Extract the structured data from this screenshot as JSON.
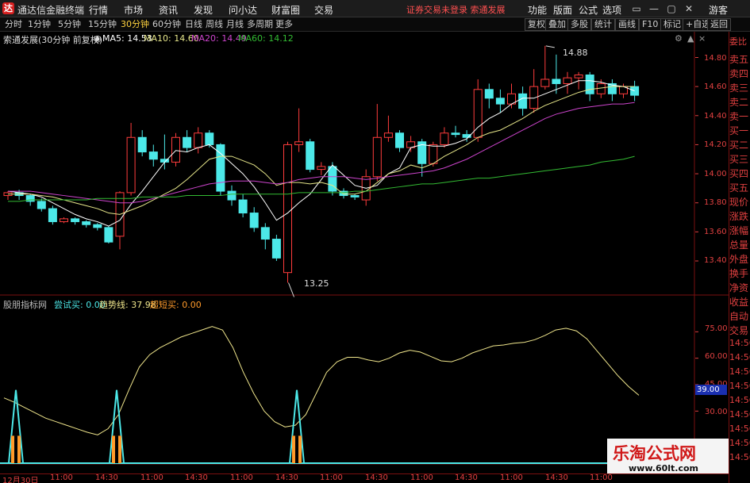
{
  "titlebar": {
    "logo": "达",
    "app_name": "通达信金融终端",
    "menus": [
      "行情",
      "市场",
      "资讯",
      "发现",
      "问小达",
      "财富圈",
      "交易"
    ],
    "notice": "证券交易未登录  索通发展",
    "right_menus": [
      "功能",
      "版面",
      "公式",
      "选项"
    ],
    "guest": "游客",
    "window_buttons": [
      "▭",
      "—",
      "▢",
      "✕"
    ]
  },
  "periodbar": {
    "tabs": [
      "分时",
      "1分钟",
      "5分钟",
      "15分钟",
      "30分钟",
      "60分钟",
      "日线",
      "周线",
      "月线",
      "多周期",
      "更多"
    ],
    "active": "30分钟",
    "tools": [
      "复权",
      "叠加",
      "多股",
      "统计",
      "画线",
      "F10",
      "标记",
      "+自选",
      "返回"
    ]
  },
  "main_legend": {
    "stock": "索通发展(30分钟 前复权)",
    "ma5": "MA5: 14.53",
    "ma10": "MA10: 14.60",
    "ma20": "MA20: 14.49",
    "ma60": "MA60: 14.12",
    "high_label": "14.88",
    "low_label": "13.25",
    "colors": {
      "ma5": "#ffffff",
      "ma10": "#e6e68a",
      "ma20": "#cc44cc",
      "ma60": "#33bb33",
      "up": "#ff3c3c",
      "down": "#4ce8e8"
    }
  },
  "indicator_legend": {
    "name": "股朋指标网",
    "try_buy": "尝试买: 0.00",
    "trend": "趋势线: 37.98",
    "super_buy": "超短买: 0.00",
    "current_value": "39.00"
  },
  "right_panel": {
    "items": [
      "委比",
      "卖五",
      "卖四",
      "卖三",
      "卖二",
      "卖一",
      "买一",
      "买二",
      "买三",
      "买四",
      "买五",
      "现价",
      "涨跌",
      "涨幅",
      "总量",
      "外盘",
      "换手",
      "净资",
      "收益",
      "自动",
      "交易"
    ],
    "times": [
      "14:56",
      "14:56",
      "14:56",
      "14:56",
      "14:56",
      "14:56",
      "14:56",
      "14:56",
      "14:56"
    ]
  },
  "date_axis": [
    "12月30日",
    "11:00",
    "14:30",
    "11:00",
    "14:30",
    "11:00",
    "14:30",
    "11:00",
    "14:30",
    "11:00",
    "14:30",
    "11:00",
    "14:30",
    "11:00"
  ],
  "watermark": {
    "title": "乐淘公式网",
    "url": "www.60lt.com"
  },
  "chart_data": {
    "type": "candlestick",
    "price_axis": {
      "ticks": [
        14.8,
        14.6,
        14.4,
        14.2,
        14.0,
        13.8,
        13.6,
        13.4
      ],
      "range": [
        13.22,
        14.95
      ]
    },
    "indicator_axis": {
      "ticks": [
        75.0,
        60.0,
        45.0,
        30.0
      ],
      "range": [
        0,
        90
      ]
    },
    "candles": [
      [
        13.85,
        13.87,
        13.82,
        13.88
      ],
      [
        13.87,
        13.85,
        13.82,
        13.89
      ],
      [
        13.85,
        13.81,
        13.78,
        13.86
      ],
      [
        13.81,
        13.76,
        13.74,
        13.83
      ],
      [
        13.76,
        13.67,
        13.65,
        13.78
      ],
      [
        13.67,
        13.69,
        13.66,
        13.7
      ],
      [
        13.69,
        13.67,
        13.65,
        13.7
      ],
      [
        13.67,
        13.65,
        13.63,
        13.68
      ],
      [
        13.65,
        13.63,
        13.61,
        13.66
      ],
      [
        13.63,
        13.53,
        13.52,
        13.64
      ],
      [
        13.57,
        13.87,
        13.48,
        13.88
      ],
      [
        13.87,
        14.25,
        13.85,
        14.35
      ],
      [
        14.25,
        14.15,
        14.12,
        14.3
      ],
      [
        14.15,
        14.1,
        14.05,
        14.2
      ],
      [
        14.1,
        14.08,
        14.03,
        14.27
      ],
      [
        14.08,
        14.25,
        14.05,
        14.28
      ],
      [
        14.25,
        14.18,
        14.15,
        14.3
      ],
      [
        14.18,
        14.28,
        14.14,
        14.32
      ],
      [
        14.28,
        14.2,
        14.18,
        14.3
      ],
      [
        14.2,
        13.88,
        13.85,
        14.21
      ],
      [
        13.88,
        13.82,
        13.78,
        13.92
      ],
      [
        13.82,
        13.73,
        13.7,
        13.86
      ],
      [
        13.73,
        13.63,
        13.6,
        13.77
      ],
      [
        13.63,
        13.55,
        13.48,
        13.66
      ],
      [
        13.55,
        13.42,
        13.4,
        13.58
      ],
      [
        13.32,
        14.2,
        13.25,
        14.22
      ],
      [
        14.2,
        14.22,
        14.15,
        14.45
      ],
      [
        14.22,
        14.03,
        14.01,
        14.24
      ],
      [
        14.03,
        14.05,
        13.99,
        14.08
      ],
      [
        14.05,
        13.88,
        13.85,
        14.08
      ],
      [
        13.88,
        13.85,
        13.83,
        13.9
      ],
      [
        13.85,
        13.84,
        13.82,
        13.86
      ],
      [
        13.82,
        13.98,
        13.78,
        14.03
      ],
      [
        13.98,
        14.25,
        13.95,
        14.48
      ],
      [
        14.25,
        14.28,
        14.22,
        14.4
      ],
      [
        14.28,
        14.18,
        14.15,
        14.3
      ],
      [
        14.18,
        14.22,
        14.15,
        14.26
      ],
      [
        14.22,
        14.07,
        13.98,
        14.24
      ],
      [
        14.07,
        14.2,
        14.05,
        14.22
      ],
      [
        14.2,
        14.28,
        14.18,
        14.32
      ],
      [
        14.28,
        14.27,
        14.25,
        14.33
      ],
      [
        14.27,
        14.25,
        14.22,
        14.3
      ],
      [
        14.25,
        14.58,
        14.22,
        14.65
      ],
      [
        14.58,
        14.52,
        14.45,
        14.62
      ],
      [
        14.52,
        14.48,
        14.42,
        14.58
      ],
      [
        14.48,
        14.55,
        14.45,
        14.62
      ],
      [
        14.55,
        14.45,
        14.4,
        14.6
      ],
      [
        14.45,
        14.6,
        14.42,
        14.72
      ],
      [
        14.6,
        14.65,
        14.58,
        14.88
      ],
      [
        14.65,
        14.62,
        14.55,
        14.82
      ],
      [
        14.62,
        14.66,
        14.55,
        14.7
      ],
      [
        14.66,
        14.68,
        14.58,
        14.7
      ],
      [
        14.68,
        14.55,
        14.5,
        14.7
      ],
      [
        14.55,
        14.62,
        14.52,
        14.65
      ],
      [
        14.62,
        14.55,
        14.5,
        14.65
      ],
      [
        14.55,
        14.6,
        14.52,
        14.62
      ],
      [
        14.6,
        14.54,
        14.5,
        14.64
      ]
    ],
    "ma_series": [
      {
        "name": "MA5",
        "values": [
          13.88,
          13.87,
          13.86,
          13.84,
          13.8,
          13.76,
          13.72,
          13.69,
          13.67,
          13.64,
          13.68,
          13.79,
          13.88,
          13.98,
          14.08,
          14.16,
          14.15,
          14.18,
          14.2,
          14.14,
          14.07,
          14.0,
          13.91,
          13.8,
          13.68,
          13.73,
          13.8,
          13.86,
          13.96,
          14.06,
          13.99,
          13.92,
          13.9,
          13.92,
          14.0,
          14.04,
          14.18,
          14.2,
          14.19,
          14.19,
          14.21,
          14.24,
          14.32,
          14.38,
          14.42,
          14.48,
          14.52,
          14.52,
          14.55,
          14.58,
          14.61,
          14.64,
          14.64,
          14.63,
          14.61,
          14.6,
          14.57
        ]
      },
      {
        "name": "MA10",
        "values": [
          13.86,
          13.86,
          13.86,
          13.85,
          13.84,
          13.82,
          13.8,
          13.78,
          13.76,
          13.73,
          13.72,
          13.75,
          13.78,
          13.82,
          13.86,
          13.9,
          13.96,
          14.03,
          14.1,
          14.12,
          14.12,
          14.09,
          14.06,
          14.0,
          13.92,
          13.94,
          13.94,
          13.93,
          13.94,
          13.92,
          13.86,
          13.86,
          13.88,
          13.94,
          14.0,
          14.02,
          14.06,
          14.04,
          14.07,
          14.12,
          14.16,
          14.2,
          14.25,
          14.28,
          14.3,
          14.34,
          14.38,
          14.43,
          14.47,
          14.5,
          14.53,
          14.56,
          14.58,
          14.59,
          14.6,
          14.6,
          14.6
        ]
      },
      {
        "name": "MA20",
        "values": [
          13.88,
          13.88,
          13.88,
          13.87,
          13.86,
          13.85,
          13.84,
          13.83,
          13.82,
          13.81,
          13.8,
          13.8,
          13.81,
          13.83,
          13.85,
          13.87,
          13.89,
          13.91,
          13.93,
          13.94,
          13.95,
          13.95,
          13.95,
          13.94,
          13.93,
          13.94,
          13.96,
          13.97,
          13.98,
          13.98,
          13.98,
          13.97,
          13.96,
          13.97,
          13.98,
          13.99,
          14.0,
          14.01,
          14.02,
          14.04,
          14.07,
          14.1,
          14.14,
          14.18,
          14.22,
          14.26,
          14.3,
          14.34,
          14.38,
          14.41,
          14.43,
          14.45,
          14.46,
          14.47,
          14.48,
          14.48,
          14.49
        ]
      },
      {
        "name": "MA60",
        "values": [
          13.81,
          13.81,
          13.82,
          13.82,
          13.82,
          13.82,
          13.82,
          13.82,
          13.83,
          13.83,
          13.83,
          13.83,
          13.84,
          13.84,
          13.84,
          13.84,
          13.85,
          13.85,
          13.85,
          13.85,
          13.86,
          13.86,
          13.86,
          13.86,
          13.86,
          13.86,
          13.87,
          13.87,
          13.87,
          13.87,
          13.87,
          13.88,
          13.88,
          13.89,
          13.9,
          13.91,
          13.92,
          13.93,
          13.93,
          13.94,
          13.95,
          13.96,
          13.97,
          13.97,
          13.98,
          13.99,
          14.0,
          14.01,
          14.02,
          14.03,
          14.04,
          14.05,
          14.06,
          14.08,
          14.09,
          14.1,
          14.12
        ]
      }
    ],
    "trend_line": [
      37.5,
      35.0,
      32.0,
      29.0,
      26.0,
      24.0,
      22.0,
      20.0,
      18.0,
      16.5,
      20.0,
      28.0,
      42.0,
      55.0,
      62.0,
      66.0,
      69.0,
      72.0,
      74.0,
      76.0,
      78.0,
      76.0,
      66.0,
      52.0,
      40.0,
      30.0,
      24.0,
      21.0,
      22.0,
      28.0,
      40.0,
      52.0,
      58.0,
      60.5,
      60.5,
      59.0,
      58.0,
      60.0,
      63.0,
      64.5,
      63.5,
      61.0,
      58.5,
      58.0,
      60.0,
      63.0,
      65.0,
      67.0,
      67.5,
      68.5,
      69.0,
      70.5,
      73.0,
      76.0,
      77.0,
      75.5,
      71.0,
      64.0,
      57.0,
      50.0,
      44.0,
      39.0
    ],
    "spikes": [
      2,
      25,
      49
    ],
    "spike_height": 42.0,
    "bar_height": 16.0
  }
}
